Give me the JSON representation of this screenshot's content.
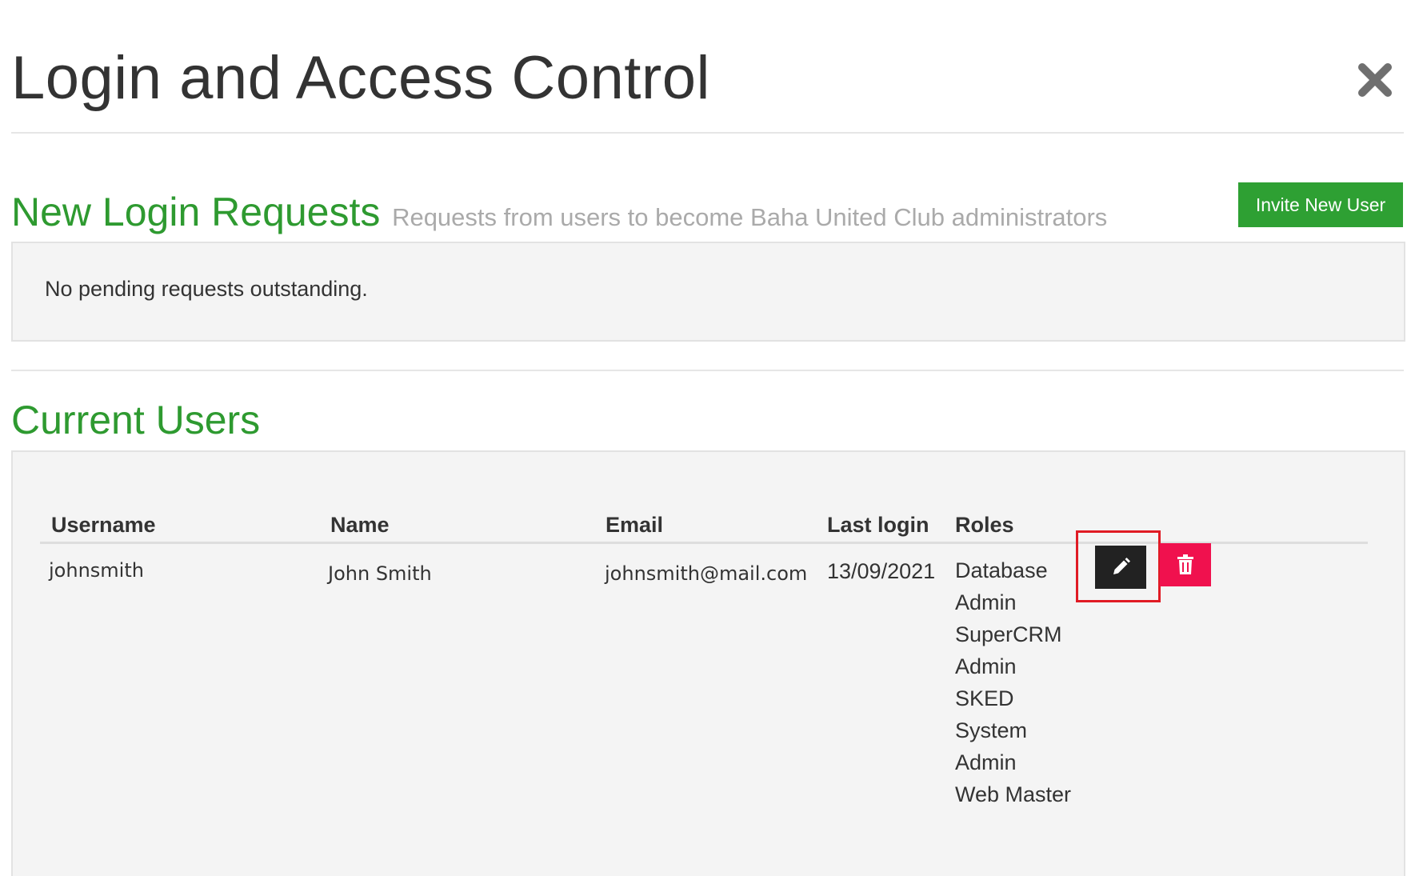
{
  "header": {
    "title": "Login and Access Control",
    "close_icon": "close-icon"
  },
  "actions": {
    "invite_label": "Invite New User"
  },
  "requests": {
    "heading": "New Login Requests",
    "subheading": "Requests from users to become Baha United Club administrators",
    "empty_message": "No pending requests outstanding."
  },
  "users": {
    "heading": "Current Users",
    "columns": {
      "username": "Username",
      "name": "Name",
      "email": "Email",
      "last_login": "Last login",
      "roles": "Roles"
    },
    "rows": [
      {
        "username": "johnsmith",
        "name": "John Smith",
        "email": "johnsmith@mail.com",
        "last_login": "13/09/2021",
        "roles": [
          "Database",
          "Admin",
          "SuperCRM",
          "Admin",
          "SKED",
          "System",
          "Admin",
          "Web Master"
        ],
        "edit_icon": "pencil-icon",
        "delete_icon": "trash-icon"
      }
    ]
  },
  "colors": {
    "accent_green": "#2e9a30",
    "button_green": "#2ea033",
    "delete_red": "#f0114e",
    "edit_dark": "#222222",
    "highlight_red": "#e01b24",
    "panel_bg": "#f4f4f4"
  }
}
